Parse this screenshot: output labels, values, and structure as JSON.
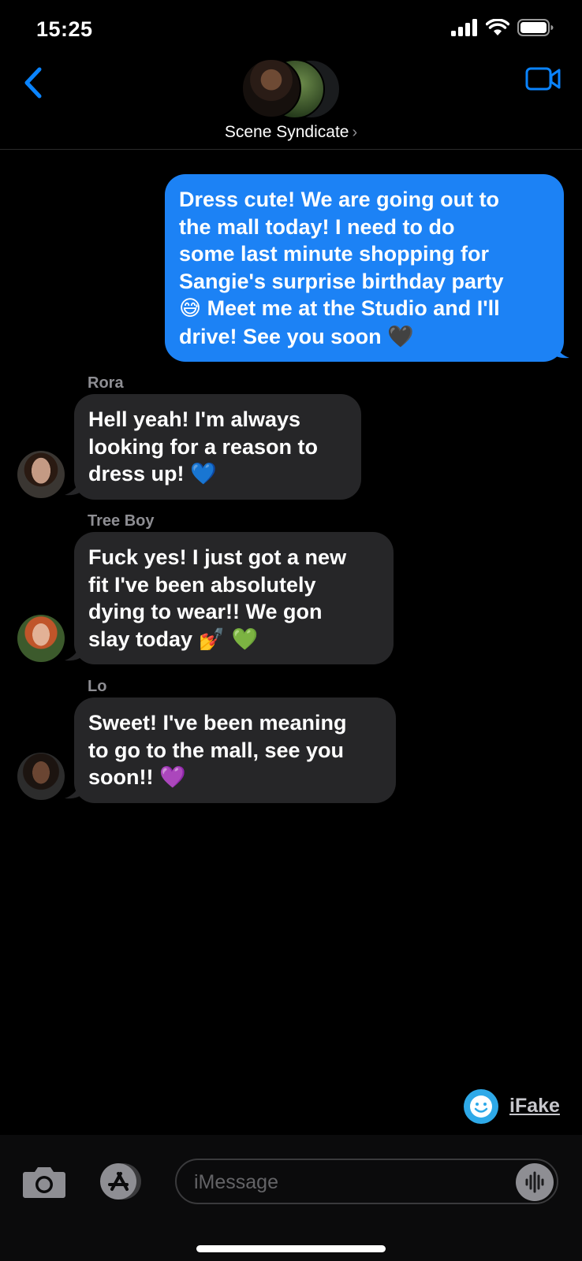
{
  "status_bar": {
    "time": "15:25"
  },
  "header": {
    "group_name": "Scene Syndicate",
    "chevron": "›"
  },
  "messages": {
    "sent_1": {
      "line1": "Dress cute! We are going out to",
      "line2": "the mall today! I need to do",
      "line3": "some last minute shopping for",
      "line4": "Sangie's surprise birthday party",
      "line5_emoji": "😅",
      "line5": " Meet me at the Studio and I'll",
      "line6": "drive! See you soon ",
      "line6_emoji": "🖤"
    },
    "rora": {
      "sender": "Rora",
      "line1": "Hell yeah! I'm always",
      "line2": "looking for a reason to",
      "line3": "dress up! ",
      "emoji": "💙"
    },
    "tree_boy": {
      "sender": "Tree Boy",
      "line1": "Fuck yes! I just got a new",
      "line2": "fit I've been absolutely",
      "line3": "dying to wear!! We gon",
      "line4": "slay today ",
      "emoji": "💅 💚"
    },
    "lo": {
      "sender": "Lo",
      "line1": "Sweet! I've been meaning",
      "line2": "to go to the mall, see you",
      "line3": "soon!! ",
      "emoji": "💜"
    }
  },
  "watermark": {
    "label": "iFake"
  },
  "input": {
    "placeholder": "iMessage"
  },
  "colors": {
    "sent_bubble": "#1c82f5",
    "received_bubble": "#262628",
    "accent": "#0a84ff",
    "background": "#000000"
  }
}
